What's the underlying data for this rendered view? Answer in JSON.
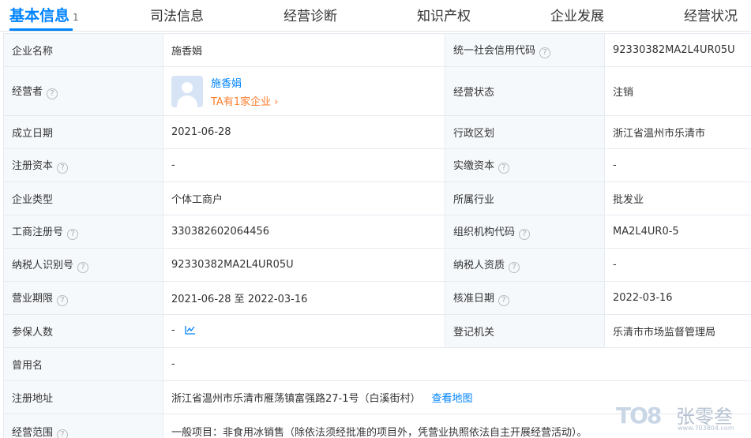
{
  "tabs": [
    {
      "label": "基本信息",
      "count": "1",
      "active": true
    },
    {
      "label": "司法信息"
    },
    {
      "label": "经营诊断"
    },
    {
      "label": "知识产权"
    },
    {
      "label": "企业发展"
    },
    {
      "label": "经营状况"
    }
  ],
  "rows": {
    "company_name": {
      "label": "企业名称",
      "value": "施香娟"
    },
    "credit_code": {
      "label": "统一社会信用代码",
      "value": "92330382MA2L4UR05U"
    },
    "operator": {
      "label": "经营者",
      "name": "施香娟",
      "link": "TA有1家企业 ›"
    },
    "status": {
      "label": "经营状态",
      "value": "注销"
    },
    "established": {
      "label": "成立日期",
      "value": "2021-06-28"
    },
    "region": {
      "label": "行政区划",
      "value": "浙江省温州市乐清市"
    },
    "reg_capital": {
      "label": "注册资本",
      "value": "-"
    },
    "paid_capital": {
      "label": "实缴资本",
      "value": "-"
    },
    "company_type": {
      "label": "企业类型",
      "value": "个体工商户"
    },
    "industry": {
      "label": "所属行业",
      "value": "批发业"
    },
    "biz_reg_no": {
      "label": "工商注册号",
      "value": "330382602064456"
    },
    "org_code": {
      "label": "组织机构代码",
      "value": "MA2L4UR0-5"
    },
    "taxpayer_id": {
      "label": "纳税人识别号",
      "value": "92330382MA2L4UR05U"
    },
    "taxpayer_qual": {
      "label": "纳税人资质",
      "value": "-"
    },
    "biz_term": {
      "label": "营业期限",
      "value": "2021-06-28 至 2022-03-16"
    },
    "approval_date": {
      "label": "核准日期",
      "value": "2022-03-16"
    },
    "insured": {
      "label": "参保人数",
      "value": "-"
    },
    "reg_authority": {
      "label": "登记机关",
      "value": "乐清市市场监督管理局"
    },
    "former_name": {
      "label": "曾用名",
      "value": "-"
    },
    "reg_address": {
      "label": "注册地址",
      "value": "浙江省温州市乐清市雁荡镇富强路27-1号（白溪街村）",
      "link": "查看地图"
    },
    "biz_scope": {
      "label": "经营范围",
      "value": "一般项目：非食用冰销售（除依法须经批准的项目外，凭营业执照依法自主开展经营活动）。"
    }
  },
  "help_icon": "?",
  "icons": {
    "help": "question-circle-icon",
    "trend": "trend-chart-icon",
    "avatar": "person-avatar-icon"
  },
  "colors": {
    "accent": "#0084ff",
    "orange_link": "#ff7c2b",
    "label_bg": "#f6f9fc"
  },
  "watermark": {
    "logo": "TO8",
    "brand": "张零叁",
    "url": "www.703804.com"
  }
}
